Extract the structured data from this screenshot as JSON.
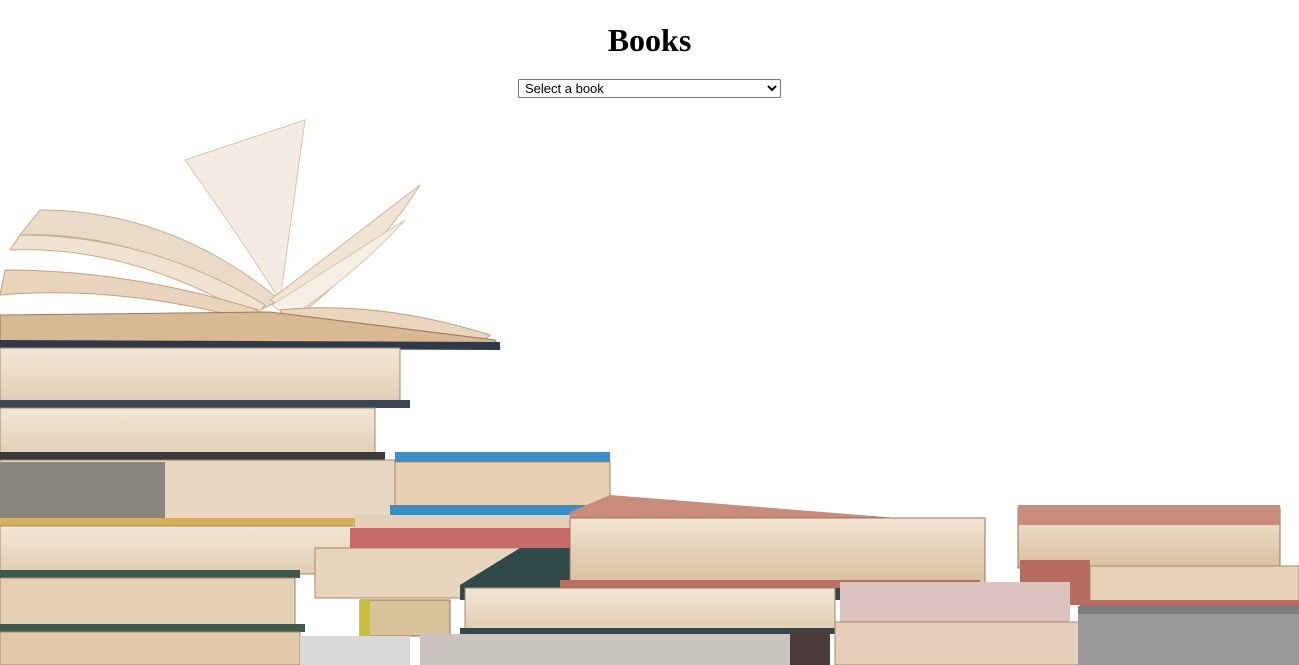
{
  "page": {
    "title": "Books"
  },
  "book_select": {
    "selected_label": "Select a book",
    "options": [
      "Select a book"
    ]
  },
  "background": {
    "icon": "stack-of-books-image"
  }
}
